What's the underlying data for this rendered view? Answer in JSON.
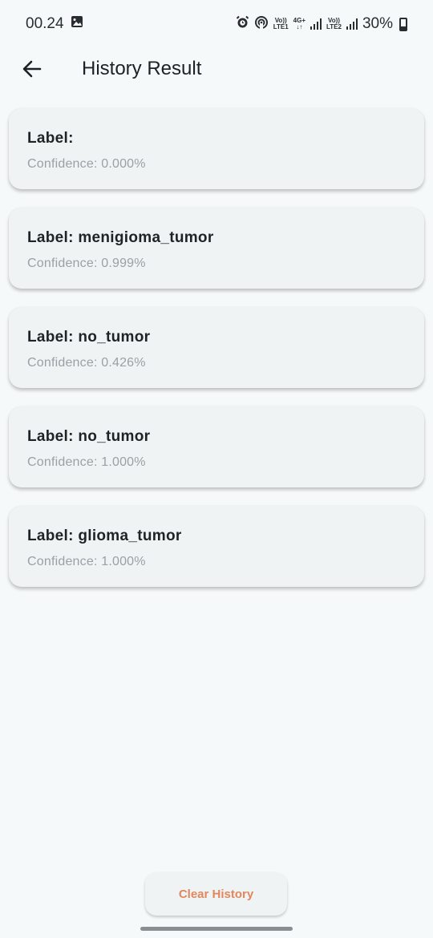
{
  "status_bar": {
    "time": "00.24",
    "sim1_top": "Vo))",
    "sim1_bottom": "LTE1",
    "network": "4G+",
    "sim2_top": "Vo))",
    "sim2_bottom": "LTE2",
    "battery": "30%",
    "icons": [
      "image-icon",
      "alarm-icon",
      "hotspot-icon",
      "signal-icon",
      "battery-icon"
    ]
  },
  "app_bar": {
    "title": "History Result",
    "back_icon": "arrow-left-icon"
  },
  "history": [
    {
      "label": "Label: ",
      "confidence": "Confidence: 0.000%"
    },
    {
      "label": "Label: menigioma_tumor",
      "confidence": "Confidence: 0.999%"
    },
    {
      "label": "Label: no_tumor",
      "confidence": "Confidence: 0.426%"
    },
    {
      "label": "Label: no_tumor",
      "confidence": "Confidence: 1.000%"
    },
    {
      "label": "Label: glioma_tumor",
      "confidence": "Confidence: 1.000%"
    }
  ],
  "clear_button": {
    "label": "Clear History"
  },
  "colors": {
    "accent": "#e0875e",
    "background": "#f6f9fa",
    "card": "#eff3f4"
  }
}
